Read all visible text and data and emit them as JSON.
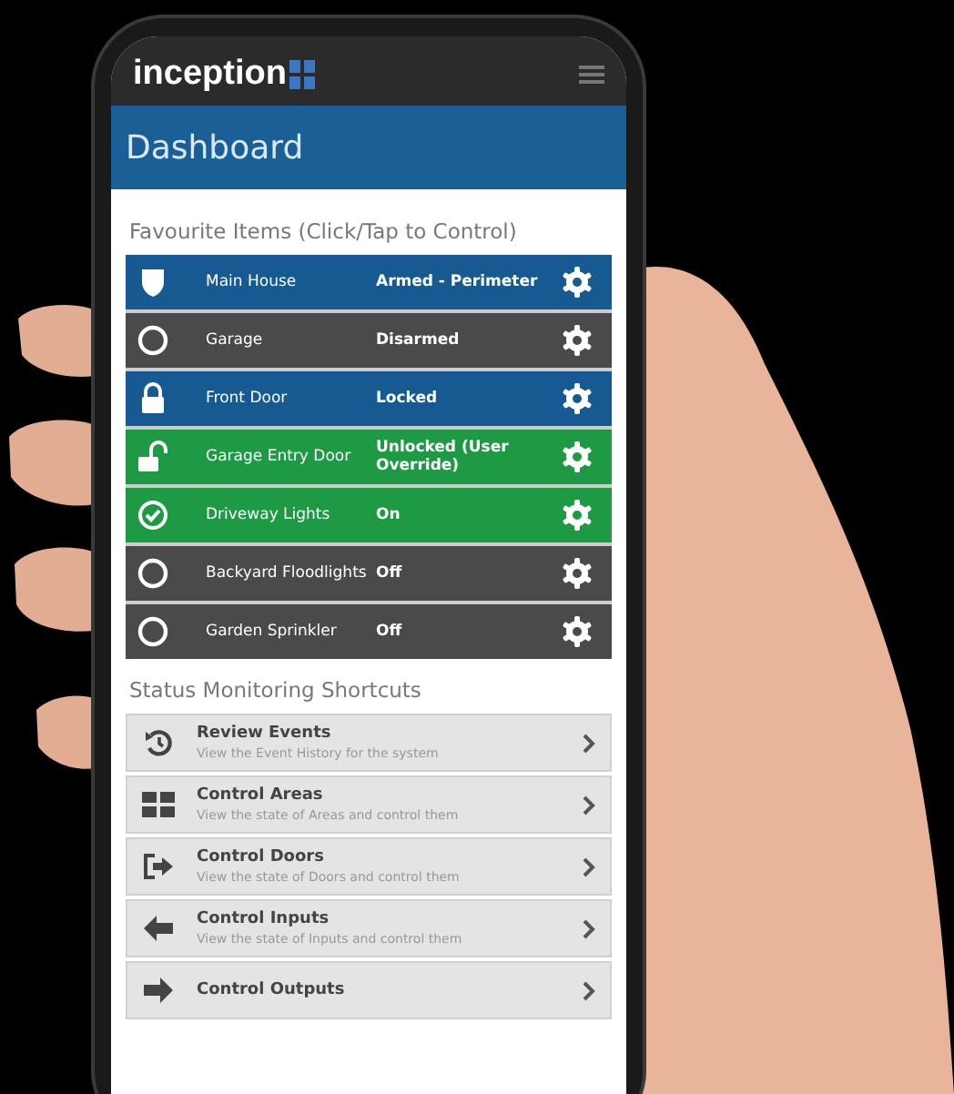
{
  "app": {
    "logo": "inception"
  },
  "title": "Dashboard",
  "favourites": {
    "heading": "Favourite Items (Click/Tap to Control)",
    "items": [
      {
        "name": "Main House",
        "status": "Armed - Perimeter",
        "kind": "shield",
        "color": "#175a92"
      },
      {
        "name": "Garage",
        "status": "Disarmed",
        "kind": "circle",
        "color": "#4a4a4a"
      },
      {
        "name": "Front Door",
        "status": "Locked",
        "kind": "lock",
        "color": "#175a92"
      },
      {
        "name": "Garage Entry Door",
        "status": "Unlocked (User Override)",
        "kind": "unlock",
        "color": "#1f9a44"
      },
      {
        "name": "Driveway Lights",
        "status": "On",
        "kind": "check",
        "color": "#1f9a44"
      },
      {
        "name": "Backyard Floodlights",
        "status": "Off",
        "kind": "circle",
        "color": "#4a4a4a"
      },
      {
        "name": "Garden Sprinkler",
        "status": "Off",
        "kind": "circle",
        "color": "#4a4a4a"
      }
    ]
  },
  "shortcuts": {
    "heading": "Status Monitoring Shortcuts",
    "items": [
      {
        "title": "Review Events",
        "description": "View the Event History for the system",
        "kind": "history"
      },
      {
        "title": "Control Areas",
        "description": "View the state of Areas and control them",
        "kind": "grid"
      },
      {
        "title": "Control Doors",
        "description": "View the state of Doors and control them",
        "kind": "door"
      },
      {
        "title": "Control Inputs",
        "description": "View the state of Inputs and control them",
        "kind": "arrow-left"
      },
      {
        "title": "Control Outputs",
        "kind": "arrow-right"
      }
    ]
  }
}
